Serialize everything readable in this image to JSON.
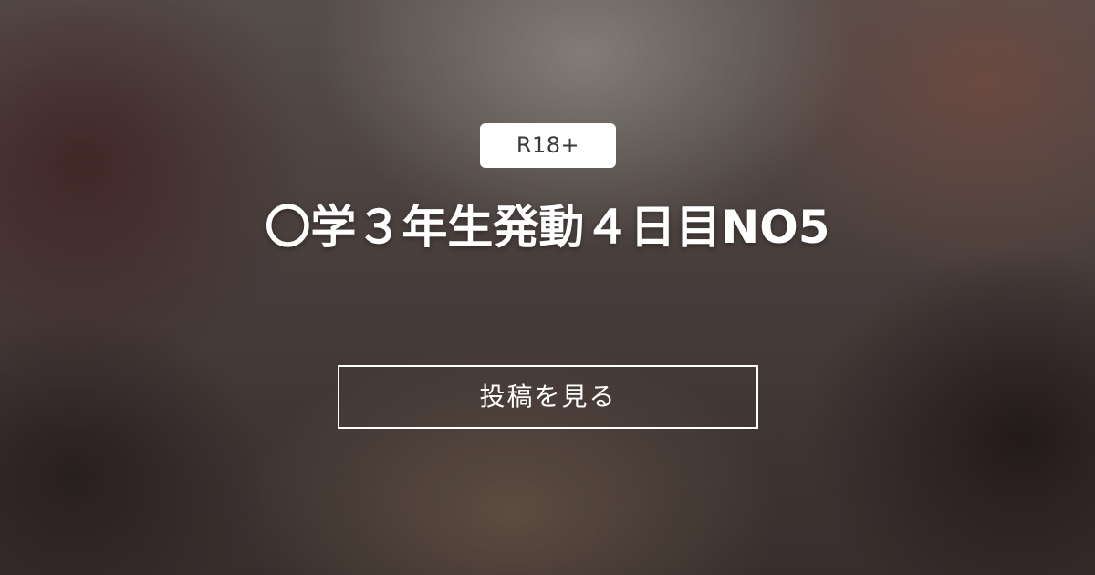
{
  "badge": {
    "label": "R18+"
  },
  "post": {
    "title": "〇学３年生発動４日目NO5"
  },
  "actions": {
    "view_post_label": "投稿を見る"
  }
}
